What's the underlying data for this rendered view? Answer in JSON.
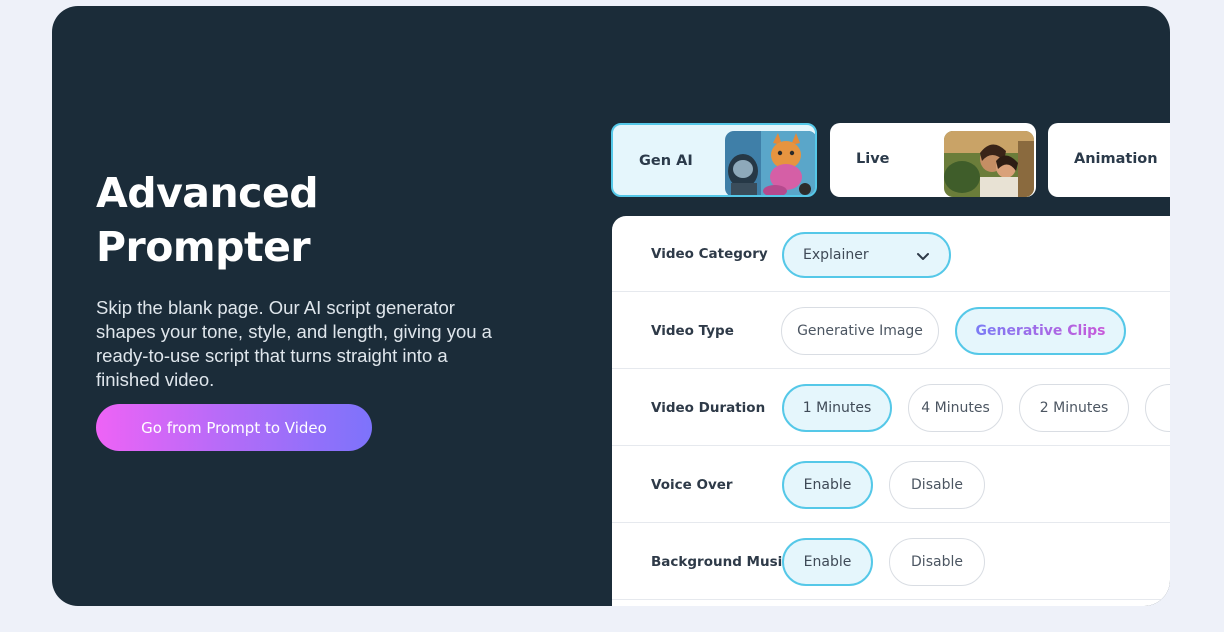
{
  "hero": {
    "title": "Advanced\nPrompter",
    "description": "Skip the blank page. Our AI script generator shapes your tone, style, and length, giving you a ready-to-use script that turns straight into a finished video.",
    "cta_label": "Go from Prompt to Video"
  },
  "tabs": [
    {
      "label": "Gen AI",
      "active": true
    },
    {
      "label": "Live",
      "active": false
    },
    {
      "label": "Animation",
      "active": false
    }
  ],
  "form": {
    "video_category": {
      "label": "Video Category",
      "value": "Explainer"
    },
    "video_type": {
      "label": "Video Type",
      "options": [
        "Generative Image",
        "Generative Clips"
      ],
      "selected": "Generative Clips"
    },
    "video_duration": {
      "label": "Video Duration",
      "options": [
        "1 Minutes",
        "4 Minutes",
        "2 Minutes"
      ],
      "selected": "1 Minutes"
    },
    "voice_over": {
      "label": "Voice Over",
      "options": [
        "Enable",
        "Disable"
      ],
      "selected": "Enable"
    },
    "background_music": {
      "label": "Background Music",
      "options": [
        "Enable",
        "Disable"
      ],
      "selected": "Enable"
    }
  },
  "colors": {
    "card_bg": "#1b2c39",
    "accent": "#55c8e8",
    "selected_bg": "#e5f6fc",
    "cta_gradient": [
      "#ee63f6",
      "#7d73fb"
    ]
  },
  "icons": {
    "dropdown": "chevron-down-icon"
  }
}
